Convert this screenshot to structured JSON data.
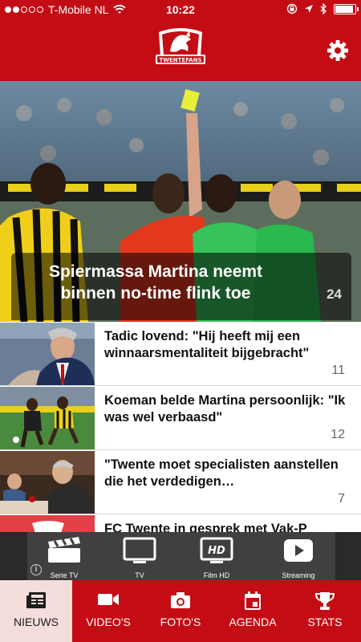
{
  "status_bar": {
    "carrier": "T-Mobile NL",
    "time": "10:22"
  },
  "header": {
    "logo_text": "TWENTEFANS",
    "settings_icon": "gear-icon"
  },
  "hero": {
    "title": "Spiermassa Martina neemt binnen no-time flink toe",
    "count": "24"
  },
  "news": [
    {
      "title": "Tadic lovend: \"Hij heeft mij een winnaarsmentaliteit bijgebracht\"",
      "count": "11"
    },
    {
      "title": "Koeman belde Martina persoonlijk: \"Ik was wel verbaasd\"",
      "count": "12"
    },
    {
      "title": "\"Twente moet specialisten aanstellen die het verdedigen…",
      "count": "7"
    },
    {
      "title": "FC Twente in gesprek met Vak-P",
      "count": ""
    }
  ],
  "ad": {
    "items": [
      {
        "label": "Serie TV",
        "icon": "clapperboard-icon"
      },
      {
        "label": "TV",
        "icon": "tv-icon"
      },
      {
        "label": "Film HD",
        "icon": "hd-monitor-icon"
      },
      {
        "label": "Streaming",
        "icon": "play-icon"
      }
    ],
    "info": "i"
  },
  "tabs": [
    {
      "label": "NIEUWS",
      "icon": "newspaper-icon",
      "active": true
    },
    {
      "label": "VIDEO'S",
      "icon": "video-camera-icon",
      "active": false
    },
    {
      "label": "FOTO'S",
      "icon": "camera-icon",
      "active": false
    },
    {
      "label": "AGENDA",
      "icon": "calendar-icon",
      "active": false
    },
    {
      "label": "STATS",
      "icon": "trophy-icon",
      "active": false
    }
  ],
  "colors": {
    "brand_red": "#c40c14",
    "active_tab_bg": "#f4dddb"
  }
}
